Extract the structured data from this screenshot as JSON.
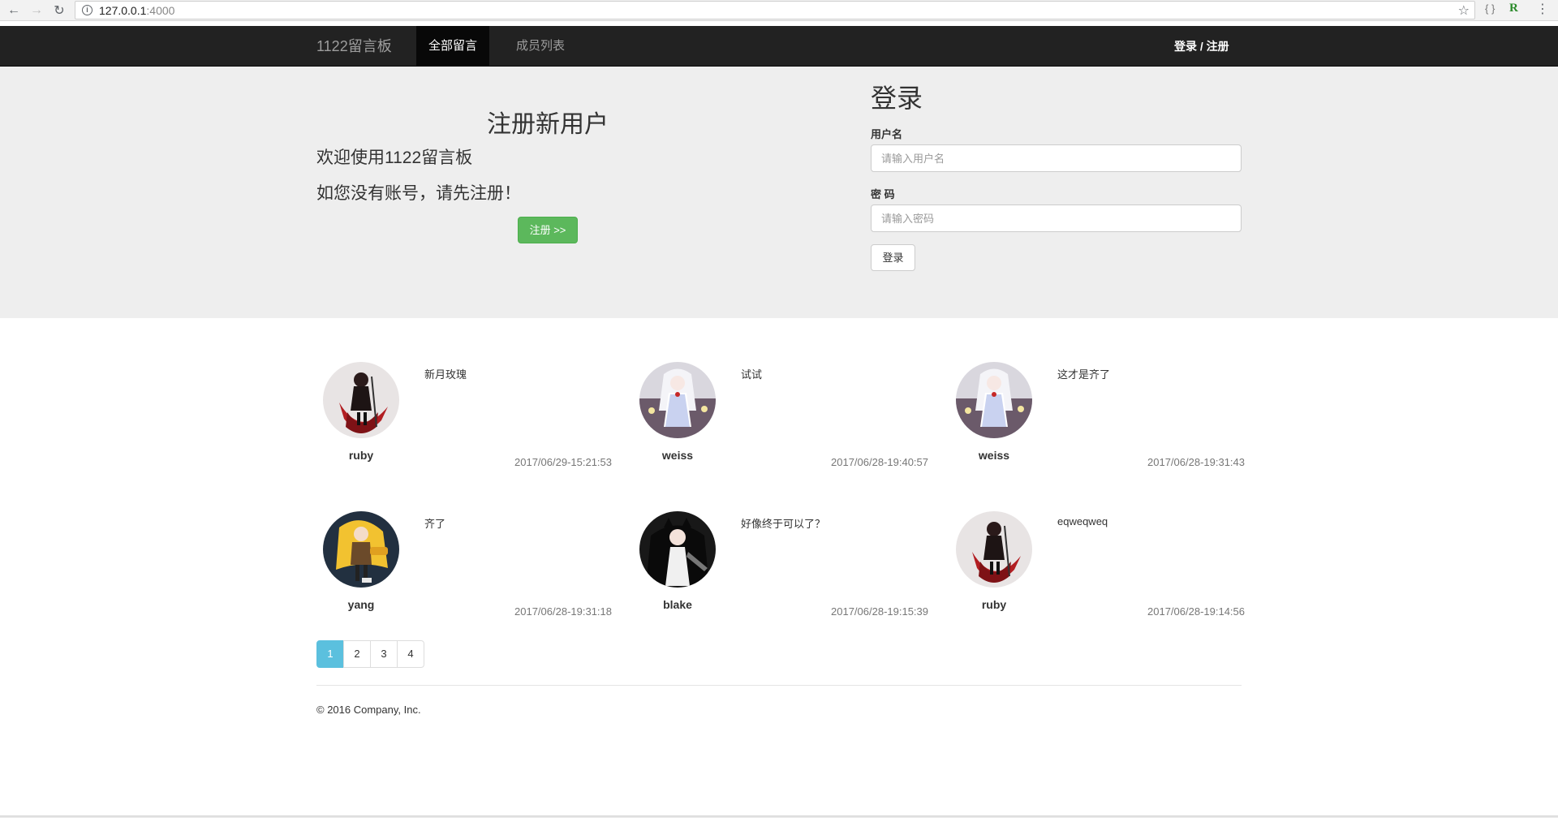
{
  "browser": {
    "url_host": "127.0.0.1",
    "url_port": ":4000"
  },
  "navbar": {
    "brand": "1122留言板",
    "tab_all": "全部留言",
    "tab_members": "成员列表",
    "login_register": "登录 / 注册"
  },
  "register": {
    "title": "注册新用户",
    "welcome": "欢迎使用1122留言板",
    "prompt": "如您没有账号，请先注册！",
    "button": "注册 >>"
  },
  "login": {
    "title": "登录",
    "username_label": "用户名",
    "username_placeholder": "请输入用户名",
    "password_label": "密 码",
    "password_placeholder": "请输入密码",
    "button": "登录"
  },
  "messages": [
    {
      "author": "ruby",
      "content": "新月玫瑰",
      "time": "2017/06/29-15:21:53",
      "avatar": "ruby-avatar"
    },
    {
      "author": "weiss",
      "content": "试试",
      "time": "2017/06/28-19:40:57",
      "avatar": "weiss-avatar"
    },
    {
      "author": "weiss",
      "content": "这才是齐了",
      "time": "2017/06/28-19:31:43",
      "avatar": "weiss-avatar"
    },
    {
      "author": "yang",
      "content": "齐了",
      "time": "2017/06/28-19:31:18",
      "avatar": "yang-avatar"
    },
    {
      "author": "blake",
      "content": "好像终于可以了？",
      "time": "2017/06/28-19:15:39",
      "avatar": "blake-avatar"
    },
    {
      "author": "ruby",
      "content": "eqweqweq",
      "time": "2017/06/28-19:14:56",
      "avatar": "ruby-avatar"
    }
  ],
  "pagination": {
    "pages": [
      "1",
      "2",
      "3",
      "4"
    ],
    "current": "1"
  },
  "footer": {
    "copyright": "© 2016 Company, Inc."
  },
  "colors": {
    "navbar_bg": "#222222",
    "jumbotron_bg": "#eeeeee",
    "register_button": "#5cb85c",
    "active_page": "#5bc0de"
  }
}
